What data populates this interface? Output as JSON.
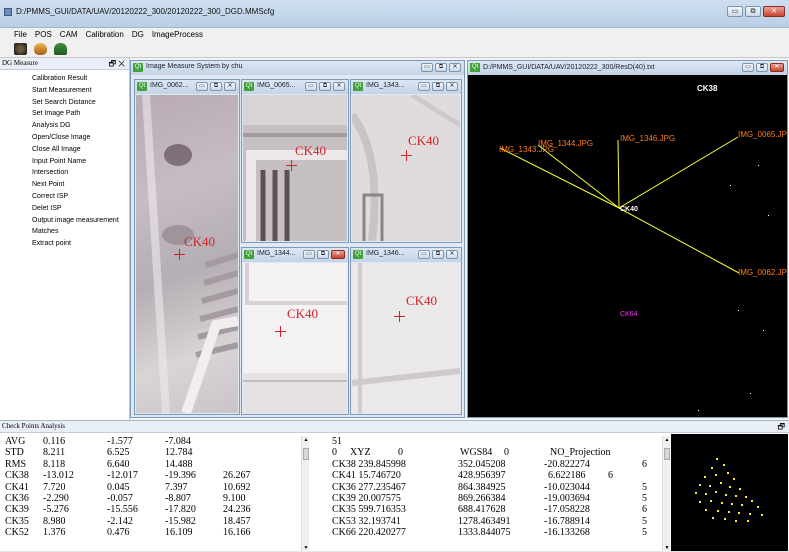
{
  "window": {
    "title": "D:/PMMS_GUI/DATA/UAV/20120222_300/20120222_300_DGD.MMScfg",
    "minimize": "▭",
    "maximize": "⧉",
    "close": "✕"
  },
  "menu": [
    "File",
    "POS",
    "CAM",
    "Calibration",
    "DG",
    "ImageProcess"
  ],
  "dg_panel": {
    "title": "DG Measure",
    "controls": "🗗 ✕",
    "items": [
      "Calibration Result",
      "Start Measurement",
      "Set Search Distance",
      "Set Image Path",
      "Analysis DG",
      "Open/Close Image",
      "Close All Image",
      "Input Point Name",
      "Intersection",
      "Next Point",
      "Correct ISP",
      "Delet ISP",
      "Output image measurement",
      "Matches",
      "Extract point"
    ]
  },
  "measure_window": {
    "title": "Image Measure System by chu",
    "qt_badge": "Qt",
    "subwindows": [
      {
        "title": "IMG_0062...",
        "label": "CK40"
      },
      {
        "title": "IMG_0065...",
        "label": "CK40"
      },
      {
        "title": "IMG_1343...",
        "label": "CK40"
      },
      {
        "title": "IMG_1344...",
        "label": "CK40"
      },
      {
        "title": "IMG_1346...",
        "label": "CK40"
      }
    ]
  },
  "residual_window": {
    "title": "D:/PMMS_GUI/DATA/UAV/20120222_300/ResD(40).txt",
    "labels": {
      "top": "CK38",
      "center": "CK40",
      "lower": "CK64",
      "img_1343": "IMG_1343.JPG",
      "img_1344": "IMG_1344.JPG",
      "img_1346": "IMG_1346.JPG",
      "img_0065": "IMG_0065.JPG",
      "img_0062": "IMG_0062.JPG"
    },
    "colors": {
      "line": "#ffff33",
      "img_label": "#ff7a1a",
      "ck_label": "#ff33ff",
      "ck_white": "#ffffff"
    }
  },
  "check_points": {
    "title": "Check Points Analysis",
    "stats_rows": [
      [
        "AVG",
        "0.116",
        "-1.577",
        "-7.084",
        ""
      ],
      [
        "STD",
        "8.211",
        "6.525",
        "12.784",
        ""
      ],
      [
        "RMS",
        "8.118",
        "6.640",
        "14.488",
        ""
      ],
      [
        "CK38",
        "-13.012",
        "-12.017",
        "-19.396",
        "26.267"
      ],
      [
        "CK41",
        "7.720",
        "0.045",
        "7.397",
        "10.692"
      ],
      [
        "CK36",
        "-2.290",
        "-0.057",
        "-8.807",
        "9.100"
      ],
      [
        "CK39",
        "-5.276",
        "-15.556",
        "-17.820",
        "24.236"
      ],
      [
        "CK35",
        "8.980",
        "-2.142",
        "-15.982",
        "18.457"
      ],
      [
        "CK52",
        "1.376",
        "0.476",
        "16.109",
        "16.166"
      ]
    ],
    "right_header": {
      "count": "51",
      "c1": "0",
      "c2": "XYZ",
      "c3": "0",
      "c4": "WGS84",
      "c5": "0",
      "c6": "NO_Projection"
    },
    "right_rows": [
      [
        "CK38 239.845998",
        "352.045208",
        "-20.822274",
        "6",
        ""
      ],
      [
        "CK41 15.746720",
        "428.956397",
        "6.622186",
        "",
        "6"
      ],
      [
        "CK36 277.235467",
        "864.384925",
        "-10.023044",
        "5",
        ""
      ],
      [
        "CK39 20.007575",
        "869.266384",
        "-19.003694",
        "5",
        ""
      ],
      [
        "CK35 599.716353",
        "688.417628",
        "-17.058228",
        "6",
        ""
      ],
      [
        "CK53 32.193741",
        "1278.463491",
        "-16.788914",
        "5",
        ""
      ],
      [
        "CK66 220.420277",
        "1333.844075",
        "-16.133268",
        "5",
        ""
      ]
    ]
  }
}
